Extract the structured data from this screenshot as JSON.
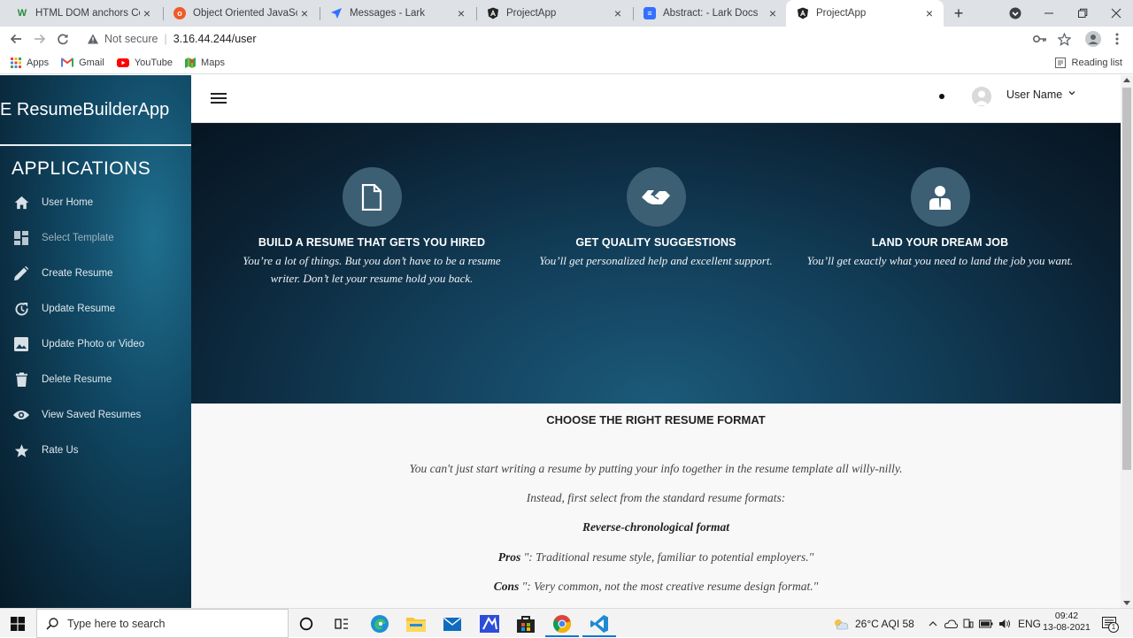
{
  "browser": {
    "tabs": [
      {
        "title": "HTML DOM anchors Collect",
        "favicon": "w-icon",
        "color": "#2b8a3e"
      },
      {
        "title": "Object Oriented JavaScripti",
        "favicon": "orange-circle-icon",
        "color": "#f05a28"
      },
      {
        "title": "Messages - Lark",
        "favicon": "lark-icon",
        "color": "#3370ff"
      },
      {
        "title": "ProjectApp",
        "favicon": "angular-icon",
        "color": "#222"
      },
      {
        "title": "Abstract: - Lark Docs",
        "favicon": "docs-icon",
        "color": "#3370ff"
      },
      {
        "title": "ProjectApp",
        "favicon": "angular-icon",
        "color": "#222",
        "active": true
      }
    ],
    "new_tab_symbol": "+",
    "security_label": "Not secure",
    "url": "3.16.44.244/user",
    "bookmarks": [
      {
        "label": "Apps",
        "icon": "apps-grid-icon"
      },
      {
        "label": "Gmail",
        "icon": "gmail-icon"
      },
      {
        "label": "YouTube",
        "icon": "youtube-icon"
      },
      {
        "label": "Maps",
        "icon": "maps-icon"
      }
    ],
    "reading_list": "Reading list"
  },
  "app": {
    "brand": "E ResumeBuilderApp",
    "section_title": "APPLICATIONS",
    "nav": [
      {
        "label": "User Home",
        "icon": "home-icon"
      },
      {
        "label": "Select Template",
        "icon": "dashboard-icon"
      },
      {
        "label": "Create Resume",
        "icon": "pencil-icon"
      },
      {
        "label": "Update Resume",
        "icon": "update-icon"
      },
      {
        "label": "Update Photo or Video",
        "icon": "image-icon"
      },
      {
        "label": "Delete Resume",
        "icon": "trash-icon"
      },
      {
        "label": "View Saved Resumes",
        "icon": "eye-icon"
      },
      {
        "label": "Rate Us",
        "icon": "star-icon"
      }
    ],
    "user_name": "User Name",
    "features": [
      {
        "title": "BUILD A RESUME THAT GETS YOU HIRED",
        "desc": "You’re a lot of things. But you don’t have to be a resume writer. Don’t let your resume hold you back.",
        "icon": "document-icon"
      },
      {
        "title": "GET QUALITY SUGGESTIONS",
        "desc": "You’ll get personalized help and excellent support.",
        "icon": "handshake-icon"
      },
      {
        "title": "LAND YOUR DREAM JOB",
        "desc": "You’ll get exactly what you need to land the job you want.",
        "icon": "person-icon"
      }
    ],
    "content": {
      "title": "CHOOSE THE RIGHT RESUME FORMAT",
      "line1": "You can't just start writing a resume by putting your info together in the resume template all willy-nilly.",
      "line2": "Instead, first select from the standard resume formats:",
      "format_name": "Reverse-chronological format",
      "pros_label": "Pros",
      "pros_text": " \": Traditional resume style, familiar to potential employers.\"",
      "cons_label": "Cons",
      "cons_text": " \": Very common, not the most creative resume design format.\""
    }
  },
  "taskbar": {
    "search_placeholder": "Type here to search",
    "weather": "26°C  AQI 58",
    "language": "ENG",
    "time": "09:42",
    "date": "13-08-2021",
    "notification_count": "1"
  }
}
